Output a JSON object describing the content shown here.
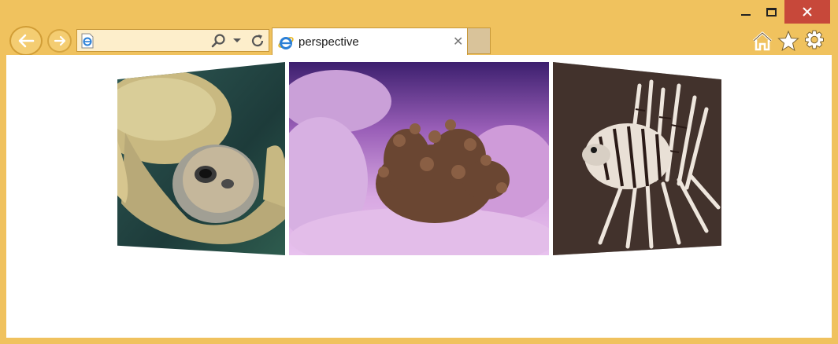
{
  "window": {
    "accent": "#f0c25e",
    "close_color": "#c7483a"
  },
  "address_bar": {
    "value": "",
    "page_icon": "ie-page-icon",
    "search_icon": "search-icon",
    "dropdown_icon": "chevron-down-icon",
    "refresh_icon": "refresh-icon"
  },
  "tabs": [
    {
      "label": "perspective",
      "icon": "ie-icon",
      "active": true
    }
  ],
  "toolbar": {
    "icons": [
      "home-icon",
      "star-icon",
      "gear-icon"
    ]
  },
  "content": {
    "images": [
      {
        "subject": "sea turtle"
      },
      {
        "subject": "coral"
      },
      {
        "subject": "lionfish"
      }
    ]
  }
}
